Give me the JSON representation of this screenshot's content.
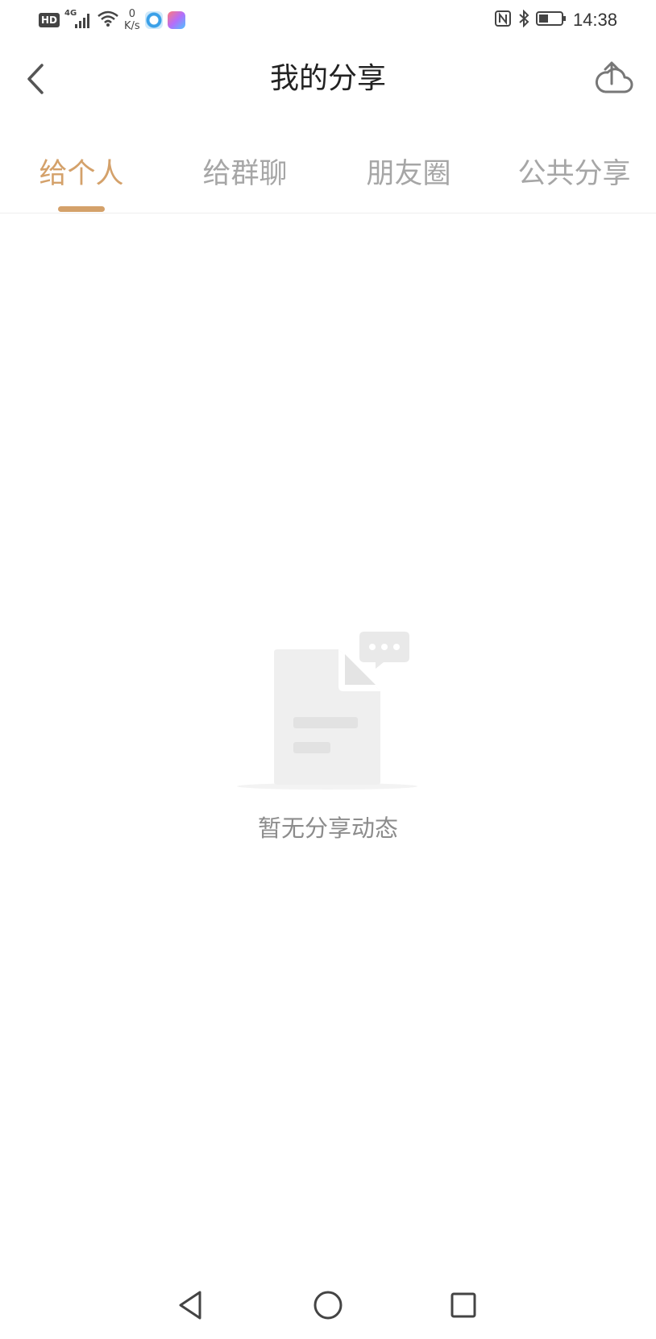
{
  "status_bar": {
    "hd_label": "HD",
    "network_type": "4G",
    "speed_value": "0",
    "speed_unit": "K/s",
    "time": "14:38",
    "icons": [
      "hd-icon",
      "signal-icon",
      "wifi-icon",
      "nfc-icon",
      "bluetooth-icon",
      "battery-icon"
    ]
  },
  "header": {
    "title": "我的分享",
    "back_icon": "chevron-left-icon",
    "upload_icon": "cloud-upload-icon"
  },
  "tabs": [
    {
      "label": "给个人",
      "active": true
    },
    {
      "label": "给群聊",
      "active": false
    },
    {
      "label": "朋友圈",
      "active": false
    },
    {
      "label": "公共分享",
      "active": false
    }
  ],
  "empty_state": {
    "message": "暂无分享动态",
    "illustration": "empty-document-chat-icon"
  },
  "nav_bar": {
    "items": [
      "back-triangle-icon",
      "home-circle-icon",
      "recents-square-icon"
    ]
  },
  "colors": {
    "accent": "#d4a16a",
    "tab_inactive": "#a6a6a6",
    "empty_text": "#8c8c8c",
    "divider": "#eeeeee"
  }
}
